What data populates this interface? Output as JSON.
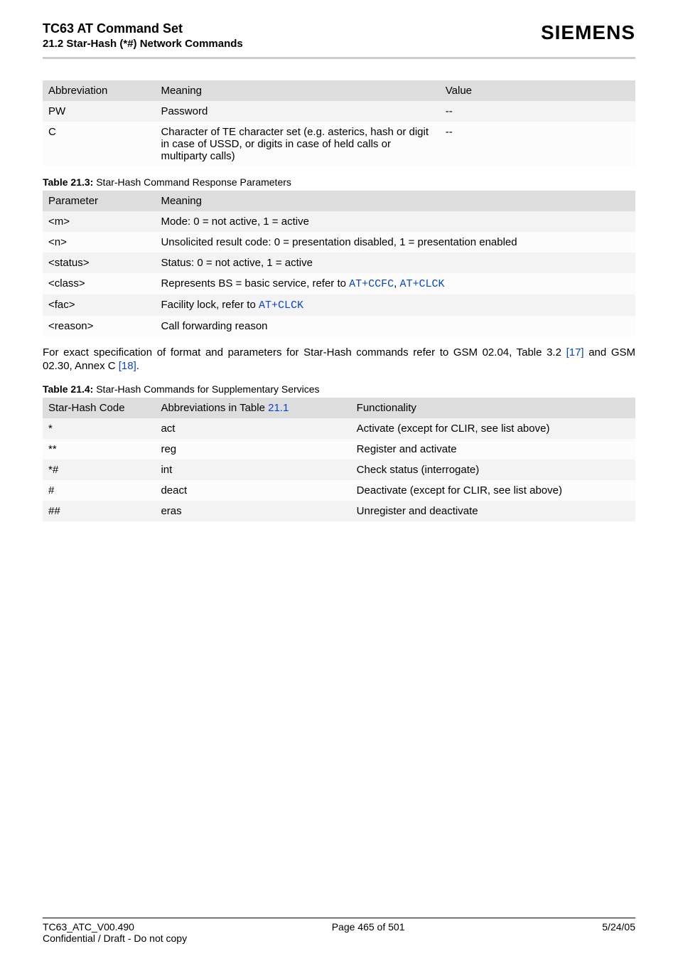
{
  "header": {
    "title": "TC63 AT Command Set",
    "subtitle": "21.2 Star-Hash (*#) Network Commands",
    "brand": "SIEMENS"
  },
  "table1": {
    "headers": {
      "c1": "Abbreviation",
      "c2": "Meaning",
      "c3": "Value"
    },
    "rows": [
      {
        "c1": "PW",
        "c2": "Password",
        "c3": "--"
      },
      {
        "c1": "C",
        "c2": "Character of TE character set (e.g. asterics, hash or digit in case of USSD, or digits in case of held calls or multiparty calls)",
        "c3": "--"
      }
    ]
  },
  "caption21_3": {
    "bold": "Table 21.3:",
    "rest": "  Star-Hash Command Response Parameters"
  },
  "table2": {
    "headers": {
      "c1": "Parameter",
      "c2": "Meaning"
    },
    "rows": [
      {
        "c1": "<m>",
        "c2": "Mode: 0 = not active, 1 = active"
      },
      {
        "c1": "<n>",
        "c2": "Unsolicited result code: 0 = presentation disabled, 1 = presentation enabled"
      },
      {
        "c1": "<status>",
        "c2": "Status: 0 = not active, 1 = active"
      }
    ],
    "class_row": {
      "c1": "<class>",
      "pre": "Represents BS = basic service, refer to ",
      "link1": "AT+CCFC",
      "sep": ", ",
      "link2": "AT+CLCK"
    },
    "fac_row": {
      "c1": "<fac>",
      "pre": "Facility lock, refer to ",
      "link1": "AT+CLCK"
    },
    "reason_row": {
      "c1": "<reason>",
      "c2": "Call forwarding reason"
    }
  },
  "para1": {
    "pre": "For exact specification of format and parameters for Star-Hash commands refer to GSM 02.04, Table 3.2 ",
    "ref17": "[17]",
    "mid": " and GSM 02.30, Annex C ",
    "ref18": "[18]",
    "post": "."
  },
  "caption21_4": {
    "bold": "Table 21.4:",
    "rest": "  Star-Hash Commands for Supplementary Services"
  },
  "table3": {
    "headers": {
      "c1": "Star-Hash Code",
      "c2_pre": "Abbreviations in Table ",
      "c2_link": "21.1",
      "c3": "Functionality"
    },
    "rows": [
      {
        "c1": "*",
        "c2": "act",
        "c3": "Activate (except for CLIR, see list above)"
      },
      {
        "c1": "**",
        "c2": "reg",
        "c3": "Register and activate"
      },
      {
        "c1": "*#",
        "c2": "int",
        "c3": "Check status (interrogate)"
      },
      {
        "c1": "#",
        "c2": "deact",
        "c3": "Deactivate (except for CLIR, see list above)"
      },
      {
        "c1": "##",
        "c2": "eras",
        "c3": "Unregister and deactivate"
      }
    ]
  },
  "footer": {
    "left1": "TC63_ATC_V00.490",
    "center": "Page 465 of 501",
    "right": "5/24/05",
    "left2": "Confidential / Draft - Do not copy"
  }
}
